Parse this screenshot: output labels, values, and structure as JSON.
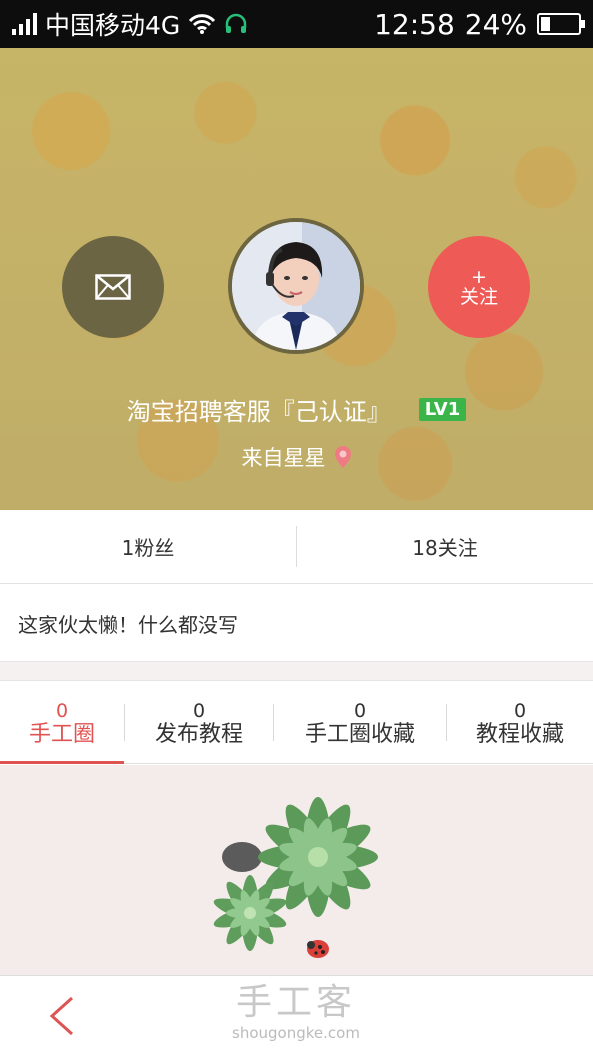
{
  "status_bar": {
    "carrier": "中国移动4G",
    "time": "12:58",
    "battery": "24%",
    "battery_level": 0.24
  },
  "profile": {
    "name": "淘宝招聘客服『己认证』",
    "level": "LV1",
    "location": "来自星星",
    "follow_plus": "+",
    "follow_label": "关注"
  },
  "stats": {
    "fans": "1粉丝",
    "following": "18关注"
  },
  "bio": "这家伙太懒！什么都没写",
  "tabs": [
    {
      "count": "0",
      "label": "手工圈",
      "active": true
    },
    {
      "count": "0",
      "label": "发布教程",
      "active": false
    },
    {
      "count": "0",
      "label": "手工圈收藏",
      "active": false
    },
    {
      "count": "0",
      "label": "教程收藏",
      "active": false
    }
  ],
  "watermark": {
    "cn": "手工客",
    "en": "shougongke.com"
  },
  "colors": {
    "accent": "#e05353",
    "follow_button": "#ee5a55",
    "level_badge": "#3bb54a"
  }
}
